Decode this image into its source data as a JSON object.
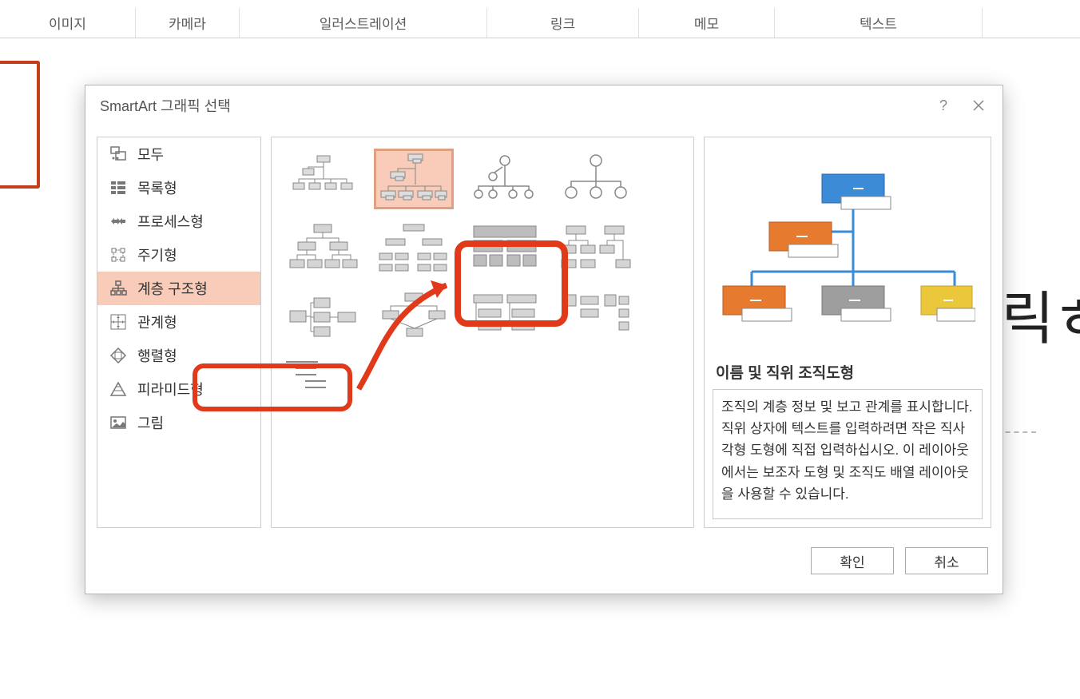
{
  "ribbon": {
    "groups": [
      "이미지",
      "카메라",
      "일러스트레이션",
      "링크",
      "메모",
      "텍스트"
    ]
  },
  "bg_text": "릭ㅎ",
  "dialog": {
    "title": "SmartArt 그래픽 선택",
    "help_symbol": "?",
    "categories": [
      {
        "label": "모두"
      },
      {
        "label": "목록형"
      },
      {
        "label": "프로세스형"
      },
      {
        "label": "주기형"
      },
      {
        "label": "계층 구조형",
        "selected": true
      },
      {
        "label": "관계형"
      },
      {
        "label": "행렬형"
      },
      {
        "label": "피라미드형"
      },
      {
        "label": "그림"
      }
    ],
    "preview": {
      "title": "이름 및 직위 조직도형",
      "desc": "조직의 계층 정보 및 보고 관계를 표시합니다. 직위 상자에 텍스트를 입력하려면 작은 직사각형 도형에 직접 입력하십시오. 이 레이아웃에서는 보조자 도형 및 조직도 배열 레이아웃을 사용할 수 있습니다."
    },
    "buttons": {
      "ok": "확인",
      "cancel": "취소"
    }
  }
}
